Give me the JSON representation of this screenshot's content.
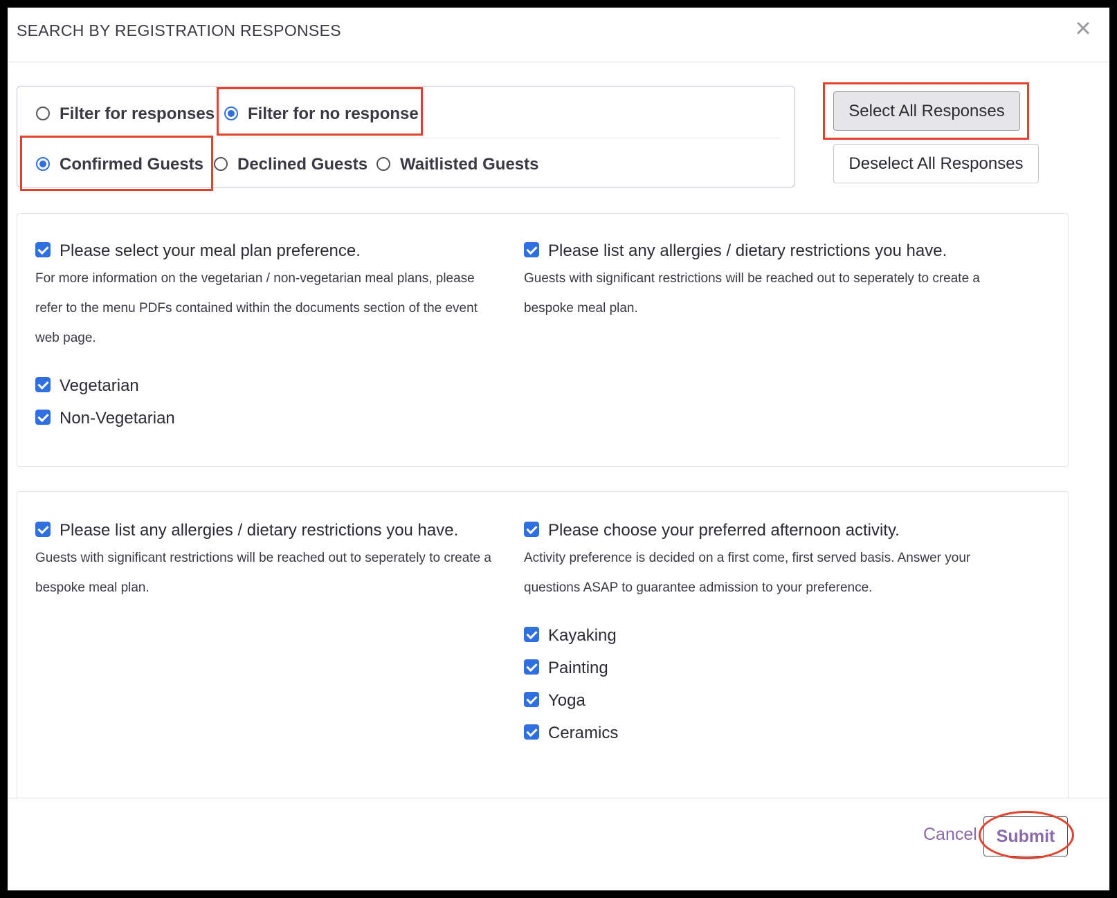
{
  "header": {
    "title": "SEARCH BY REGISTRATION RESPONSES",
    "close_glyph": "×"
  },
  "filters": {
    "response_mode": [
      {
        "label": "Filter for responses",
        "selected": false
      },
      {
        "label": "Filter for no response",
        "selected": true
      }
    ],
    "guest_status": [
      {
        "label": "Confirmed Guests",
        "selected": true
      },
      {
        "label": "Declined Guests",
        "selected": false
      },
      {
        "label": "Waitlisted Guests",
        "selected": false
      }
    ]
  },
  "actions": {
    "select_all": "Select All Responses",
    "deselect_all": "Deselect All Responses"
  },
  "cards": [
    {
      "questions": [
        {
          "title": "Please select your meal plan preference.",
          "checked": true,
          "description": "For more information on the vegetarian / non-vegetarian meal plans, please refer to the menu PDFs contained within the documents section of the event web page.",
          "options": [
            {
              "label": "Vegetarian",
              "checked": true
            },
            {
              "label": "Non-Vegetarian",
              "checked": true
            }
          ]
        },
        {
          "title": "Please list any allergies / dietary restrictions you have.",
          "checked": true,
          "description": "Guests with significant restrictions will be reached out to seperately to create a bespoke meal plan.",
          "options": []
        }
      ]
    },
    {
      "questions": [
        {
          "title": "Please list any allergies / dietary restrictions you have.",
          "checked": true,
          "description": "Guests with significant restrictions will be reached out to seperately to create a bespoke meal plan.",
          "options": []
        },
        {
          "title": "Please choose your preferred afternoon activity.",
          "checked": true,
          "description": "Activity preference is decided on a first come, first served basis. Answer your questions ASAP to guarantee admission to your preference.",
          "options": [
            {
              "label": "Kayaking",
              "checked": true
            },
            {
              "label": "Painting",
              "checked": true
            },
            {
              "label": "Yoga",
              "checked": true
            },
            {
              "label": "Ceramics",
              "checked": true
            }
          ]
        }
      ]
    }
  ],
  "footer": {
    "cancel": "Cancel",
    "submit": "Submit"
  },
  "colors": {
    "accent": "#2f6fe0",
    "highlight": "#e2412c",
    "link": "#8a6aa8",
    "filter_border": "#c8bde0"
  }
}
